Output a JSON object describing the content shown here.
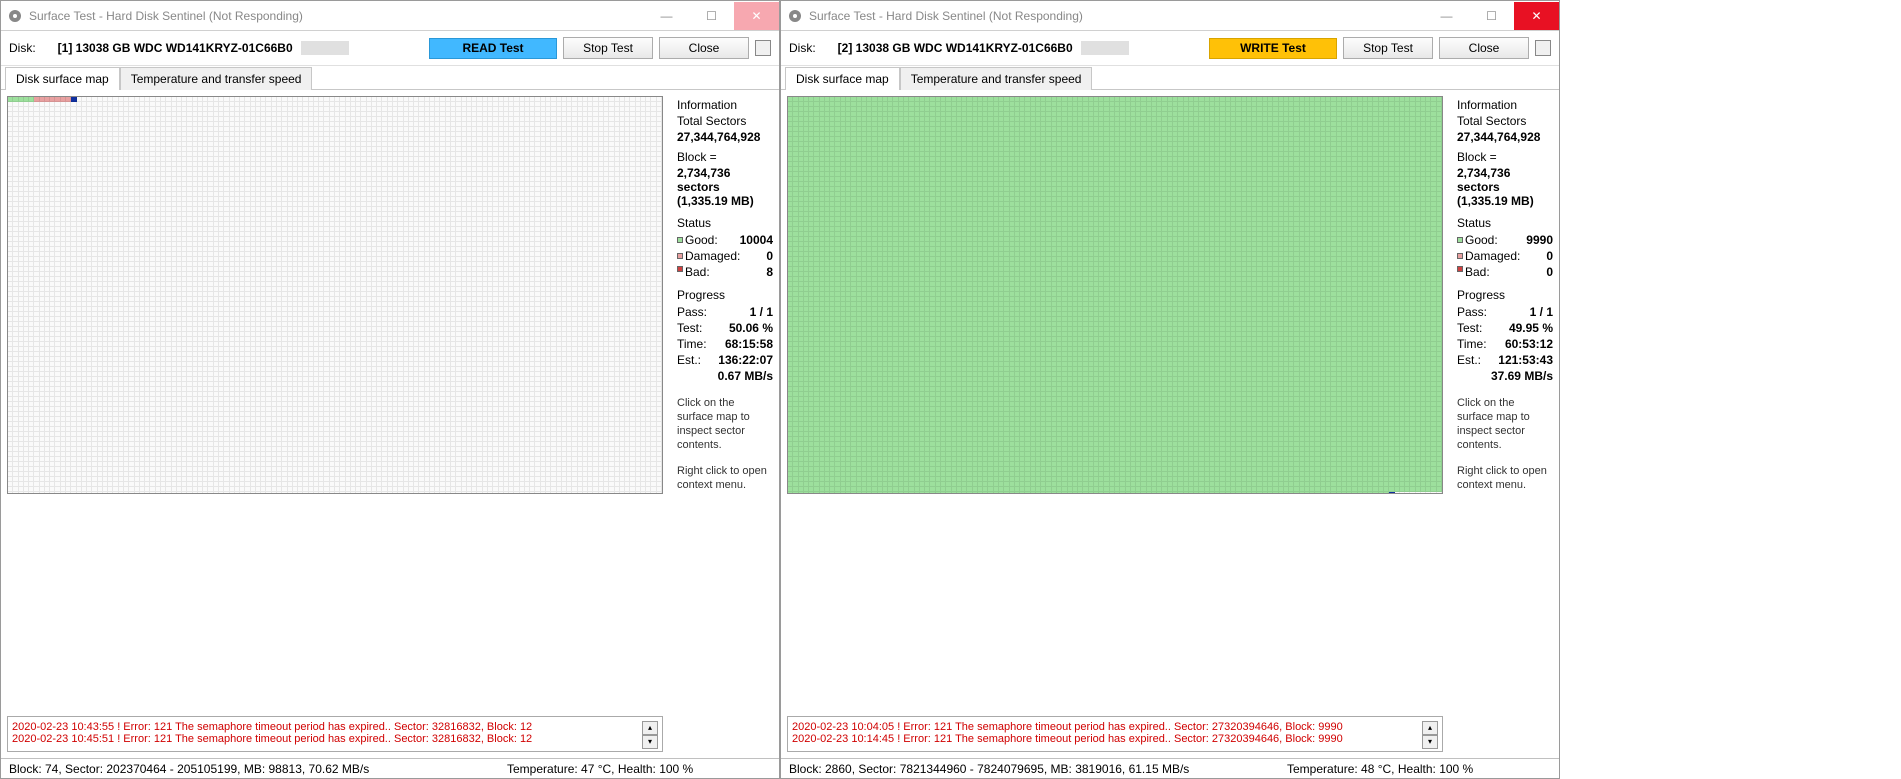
{
  "left": {
    "title": "Surface Test - Hard Disk Sentinel (Not Responding)",
    "disk_label": "Disk:",
    "disk_name": "[1] 13038 GB  WDC WD141KRYZ-01C66B0",
    "btn_test": "READ Test",
    "btn_stop": "Stop Test",
    "btn_close": "Close",
    "tab1": "Disk surface map",
    "tab2": "Temperature and transfer speed",
    "info": {
      "information": "Information",
      "total_sectors_l": "Total Sectors",
      "total_sectors_v": "27,344,764,928",
      "block_l": "Block =",
      "block_sectors": "2,734,736 sectors",
      "block_mb": "(1,335.19 MB)",
      "status": "Status",
      "good_l": "Good:",
      "good_v": "10004",
      "damaged_l": "Damaged:",
      "damaged_v": "0",
      "bad_l": "Bad:",
      "bad_v": "8",
      "progress": "Progress",
      "pass_l": "Pass:",
      "pass_v": "1 / 1",
      "test_l": "Test:",
      "test_v": "50.06 %",
      "time_l": "Time:",
      "time_v": "68:15:58",
      "est_l": "Est.:",
      "est_v": "136:22:07",
      "rate": "0.67 MB/s",
      "hint1": "Click on the surface map to inspect sector contents.",
      "hint2": "Right click to open context menu."
    },
    "log1": "2020-02-23  10:43:55 ! Error: 121 The semaphore timeout period has expired.. Sector: 32816832, Block: 12",
    "log2": "2020-02-23  10:45:51 ! Error: 121 The semaphore timeout period has expired.. Sector: 32816832, Block: 12",
    "status_left": "Block: 74, Sector: 202370464 - 205105199, MB: 98813, 70.62 MB/s",
    "status_mid": "Temperature: 47  °C,  Health: 100 %"
  },
  "right": {
    "title": "Surface Test - Hard Disk Sentinel (Not Responding)",
    "disk_label": "Disk:",
    "disk_name": "[2] 13038 GB  WDC WD141KRYZ-01C66B0",
    "btn_test": "WRITE Test",
    "btn_stop": "Stop Test",
    "btn_close": "Close",
    "tab1": "Disk surface map",
    "tab2": "Temperature and transfer speed",
    "info": {
      "information": "Information",
      "total_sectors_l": "Total Sectors",
      "total_sectors_v": "27,344,764,928",
      "block_l": "Block =",
      "block_sectors": "2,734,736 sectors",
      "block_mb": "(1,335.19 MB)",
      "status": "Status",
      "good_l": "Good:",
      "good_v": "9990",
      "damaged_l": "Damaged:",
      "damaged_v": "0",
      "bad_l": "Bad:",
      "bad_v": "0",
      "progress": "Progress",
      "pass_l": "Pass:",
      "pass_v": "1 / 1",
      "test_l": "Test:",
      "test_v": "49.95 %",
      "time_l": "Time:",
      "time_v": "60:53:12",
      "est_l": "Est.:",
      "est_v": "121:53:43",
      "rate": "37.69 MB/s",
      "hint1": "Click on the surface map to inspect sector contents.",
      "hint2": "Right click to open context menu."
    },
    "log1": "2020-02-23  10:04:05 ! Error: 121 The semaphore timeout period has expired.. Sector: 27320394646, Block: 9990",
    "log2": "2020-02-23  10:14:45 ! Error: 121 The semaphore timeout period has expired.. Sector: 27320394646, Block: 9990",
    "status_left": "Block: 2860, Sector: 7821344960 - 7824079695, MB: 3819016, 61.15 MB/s",
    "status_mid": "Temperature: 48  °C,  Health: 100 %"
  }
}
